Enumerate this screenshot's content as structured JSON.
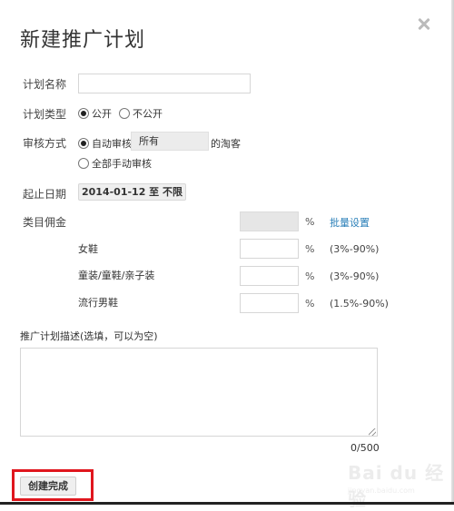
{
  "dialog": {
    "title": "新建推广计划",
    "close_icon": "close-icon"
  },
  "form": {
    "plan_name": {
      "label": "计划名称",
      "value": "",
      "placeholder": ""
    },
    "plan_type": {
      "label": "计划类型",
      "options": [
        {
          "label": "公开",
          "selected": true
        },
        {
          "label": "不公开",
          "selected": false
        }
      ]
    },
    "review_method": {
      "label": "审核方式",
      "options": [
        {
          "label": "自动审核",
          "selected": true
        },
        {
          "label": "全部手动审核",
          "selected": false
        }
      ],
      "audience_select": "所有",
      "audience_suffix": "的淘客"
    },
    "date_range": {
      "label": "起止日期",
      "value": "2014-01-12 至 不限"
    },
    "category_commission": {
      "label": "类目佣金",
      "batch_value": "",
      "percent_sign": "%",
      "batch_link": "批量设置",
      "categories": [
        {
          "name": "女鞋",
          "value": "",
          "range": "(3%-90%)"
        },
        {
          "name": "童装/童鞋/亲子装",
          "value": "",
          "range": "(3%-90%)"
        },
        {
          "name": "流行男鞋",
          "value": "",
          "range": "(1.5%-90%)"
        }
      ]
    },
    "description": {
      "label": "推广计划描述(选填，可以为空)",
      "value": "",
      "counter": "0/500"
    }
  },
  "footer": {
    "submit_label": "创建完成"
  },
  "watermark": {
    "brand": "Bai du 经验",
    "url": "jingyan.baidu.com"
  },
  "colors": {
    "link": "#2a7fb8",
    "highlight": "#e0161e"
  }
}
